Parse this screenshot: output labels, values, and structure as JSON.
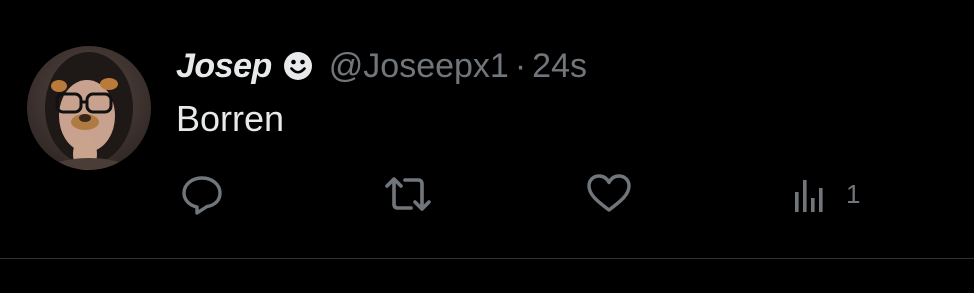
{
  "tweet": {
    "author": {
      "display_name": "Josep",
      "badge_icon": "smiley-icon",
      "handle": "@Joseepx1"
    },
    "separator": "·",
    "timestamp": "24s",
    "text": "Borren",
    "actions": {
      "reply": {
        "icon": "reply-icon",
        "count": ""
      },
      "retweet": {
        "icon": "retweet-icon",
        "count": ""
      },
      "like": {
        "icon": "heart-icon",
        "count": ""
      },
      "views": {
        "icon": "views-icon",
        "count": "1"
      }
    }
  },
  "colors": {
    "background": "#000000",
    "primary_text": "#e7e9ea",
    "secondary_text": "#71767b",
    "divider": "#2f3336"
  }
}
